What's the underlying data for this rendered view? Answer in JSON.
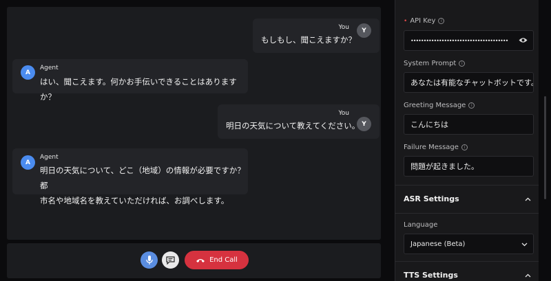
{
  "chat": {
    "messages": [
      {
        "role": "user",
        "name": "You",
        "avatar": "Y",
        "text": "もしもし、聞こえますか？"
      },
      {
        "role": "agent",
        "name": "Agent",
        "avatar": "A",
        "text": "はい、聞こえます。何かお手伝いできることはありますか？"
      },
      {
        "role": "user",
        "name": "You",
        "avatar": "Y",
        "text": "明日の天気について教えてください。"
      },
      {
        "role": "agent",
        "name": "Agent",
        "avatar": "A",
        "text": "明日の天気について、どこ（地域）の情報が必要ですか？ 都\n市名や地域名を教えていただければ、お調べします。"
      }
    ]
  },
  "controls": {
    "mic_icon": "microphone-icon",
    "chat_icon": "chat-bubble-icon",
    "end_call_label": "End Call",
    "end_call_icon": "phone-hangup-icon",
    "end_color": "#d6323f"
  },
  "settings": {
    "api_key_label": "API Key",
    "api_key_value": "••••••••••••••••••••••••••••••••••••••",
    "system_prompt_label": "System Prompt",
    "system_prompt_value": "あなたは有能なチャットボットです。",
    "greeting_label": "Greeting Message",
    "greeting_value": "こんにちは",
    "failure_label": "Failure Message",
    "failure_value": "問題が起きました。",
    "asr_section": "ASR Settings",
    "language_label": "Language",
    "language_value": "Japanese (Beta)",
    "tts_section": "TTS Settings"
  }
}
